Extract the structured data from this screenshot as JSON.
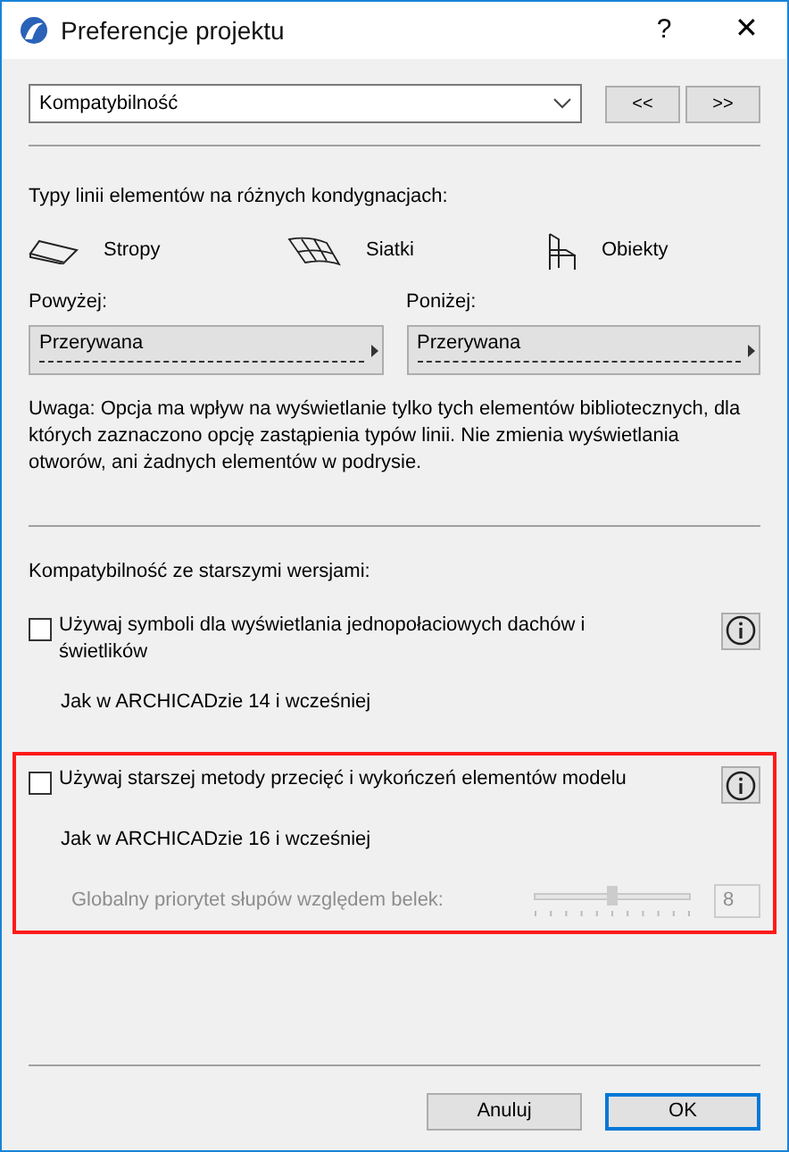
{
  "window": {
    "title": "Preferencje projektu",
    "help": "?",
    "close": "✕"
  },
  "page_select": {
    "value": "Kompatybilność"
  },
  "nav_buttons": [
    "<<",
    ">>"
  ],
  "line_types": {
    "heading": "Typy linii elementów na różnych kondygnacjach:",
    "categories": [
      {
        "kind": "slab",
        "label": "Stropy"
      },
      {
        "kind": "mesh",
        "label": "Siatki"
      },
      {
        "kind": "object",
        "label": "Obiekty"
      }
    ],
    "above": {
      "label": "Powyżej:",
      "value": "Przerywana"
    },
    "below": {
      "label": "Poniżej:",
      "value": "Przerywana"
    },
    "note": "Uwaga: Opcja ma wpływ na wyświetlanie tylko tych elementów bibliotecznych, dla których zaznaczono opcję zastąpienia typów linii. Nie zmienia wyświetlania otworów, ani żadnych elementów w podrysie."
  },
  "compatibility": {
    "heading": "Kompatybilność ze starszymi wersjami:",
    "options": [
      {
        "label": "Używaj symboli dla wyświetlania jednopołaciowych dachów i świetlików",
        "checked": false,
        "highlighted": false,
        "note": "Jak w ARCHICADzie 14 i wcześniej"
      },
      {
        "label": "Używaj starszej metody przecięć i wykończeń elementów modelu",
        "checked": false,
        "highlighted": true,
        "note": "Jak w ARCHICADzie 16 i wcześniej",
        "slider": {
          "label": "Globalny priorytet słupów względem belek:",
          "level": 0.5,
          "value": "8",
          "disabled": true
        }
      }
    ]
  },
  "buttons": [
    {
      "label": "Anuluj",
      "default": false
    },
    {
      "label": "OK",
      "default": true
    }
  ]
}
